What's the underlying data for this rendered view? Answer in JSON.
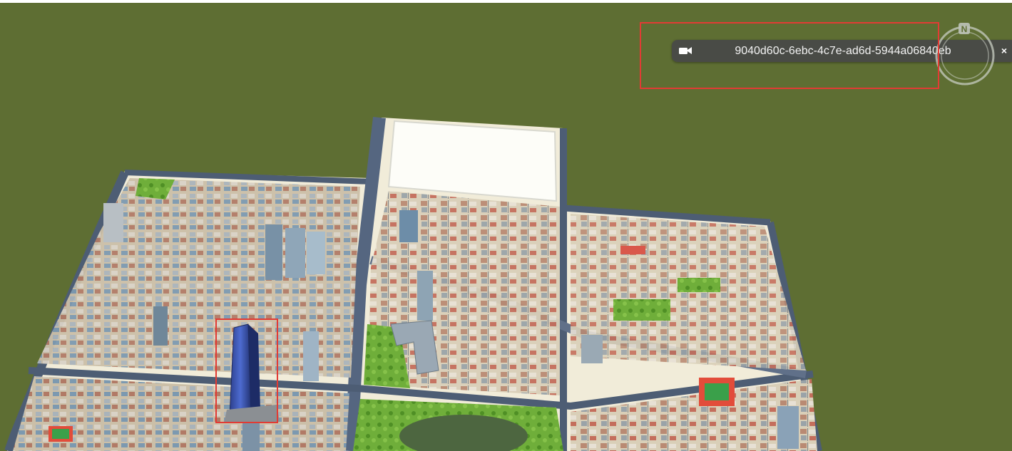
{
  "camera_bar": {
    "camera_id": "9040d60c-6ebc-4c7e-ad6d-5944a06840eb",
    "close_glyph": "×",
    "camera_icon": "video-camera-icon"
  },
  "compass": {
    "north_label": "N",
    "icon": "compass-icon"
  },
  "scene": {
    "background": "#5e6e33",
    "highlight_color": "#e23b34"
  }
}
